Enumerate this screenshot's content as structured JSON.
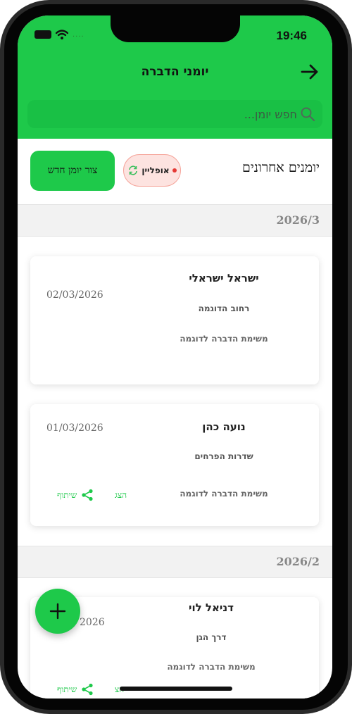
{
  "status": {
    "time": "19:46",
    "dots": "...."
  },
  "header": {
    "title": "יומני הדברה"
  },
  "search": {
    "placeholder": "חפש יומן..."
  },
  "list_header": {
    "title": "יומנים אחרונים",
    "offline_label": "אופליין",
    "new_button": "צור יומן חדש"
  },
  "colors": {
    "accent": "#1ec94a",
    "offline_bg": "#fde3e0",
    "offline_dot": "#e53935"
  },
  "groups": [
    {
      "month": "2026/3"
    },
    {
      "month": "2026/2"
    }
  ],
  "entries": [
    {
      "name": "ישראל ישראלי",
      "street": "רחוב הדוגמה",
      "task": "משימת הדברה לדוגמה",
      "date": "02/03/2026"
    },
    {
      "name": "נועה כהן",
      "street": "שדרות הפרחים",
      "task": "משימת הדברה לדוגמה",
      "date": "01/03/2026",
      "show": "הצג",
      "share": "שיתוף"
    },
    {
      "name": "דניאל לוי",
      "street": "דרך הגן",
      "task": "משימת הדברה לדוגמה",
      "date_partial": "2026",
      "show_partial": "הצ",
      "share": "שיתוף"
    }
  ],
  "icons": [
    "back-arrow-icon",
    "search-icon",
    "sync-icon",
    "share-icon",
    "plus-icon"
  ]
}
